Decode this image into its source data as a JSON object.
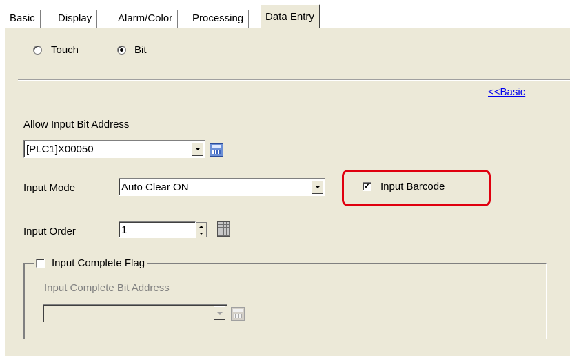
{
  "tabs": [
    {
      "label": "Basic",
      "active": false
    },
    {
      "label": "Display",
      "active": false
    },
    {
      "label": "Alarm/Color",
      "active": false
    },
    {
      "label": "Processing",
      "active": false
    },
    {
      "label": "Data Entry",
      "active": true
    }
  ],
  "mode": {
    "touch_label": "Touch",
    "bit_label": "Bit",
    "selected": "Bit"
  },
  "basic_link": "<<Basic",
  "allow_input": {
    "label": "Allow Input Bit Address",
    "value": "[PLC1]X00050"
  },
  "input_mode": {
    "label": "Input Mode",
    "value": "Auto Clear ON"
  },
  "input_barcode": {
    "label": "Input Barcode",
    "checked": true
  },
  "input_order": {
    "label": "Input Order",
    "value": "1"
  },
  "input_complete": {
    "flag_label": "Input Complete Flag",
    "flag_checked": false,
    "address_label": "Input Complete Bit Address",
    "address_value": ""
  },
  "colors": {
    "panel_bg": "#ece9d8",
    "highlight": "#e0000f",
    "link": "#0000ee"
  },
  "icons": {
    "address_input": "address-entry-icon",
    "keypad": "keypad-icon"
  }
}
